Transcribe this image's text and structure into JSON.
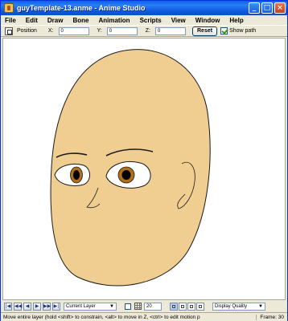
{
  "window": {
    "title": "guyTemplate-13.anme - Anime Studio",
    "minimize": "_",
    "maximize": "□",
    "close": "×"
  },
  "menu": [
    "File",
    "Edit",
    "Draw",
    "Bone",
    "Animation",
    "Scripts",
    "View",
    "Window",
    "Help"
  ],
  "toolbar": {
    "position_label": "Position",
    "x_label": "X:",
    "x_value": "0",
    "y_label": "Y:",
    "y_value": "0",
    "z_label": "Z:",
    "z_value": "0",
    "reset_label": "Reset",
    "show_path_label": "Show path",
    "show_path_checked": true
  },
  "timeline": {
    "buttons": [
      "|◀",
      "◀◀",
      "◀",
      "▶",
      "▶▶",
      "▶|"
    ],
    "layer_select": "Current Layer",
    "grid_size": "20",
    "quality_select": "Display Quality"
  },
  "status": {
    "message": "Move entire layer (hold <shift> to constrain, <alt> to move in Z, <ctrl> to edit motion p",
    "frame": "Frame: 30"
  },
  "colors": {
    "skin": "#f0cd90",
    "iris": "#b0701a",
    "pupil": "#000000",
    "outline": "#1a1a1a",
    "titlebar": "#0a5fe8"
  }
}
